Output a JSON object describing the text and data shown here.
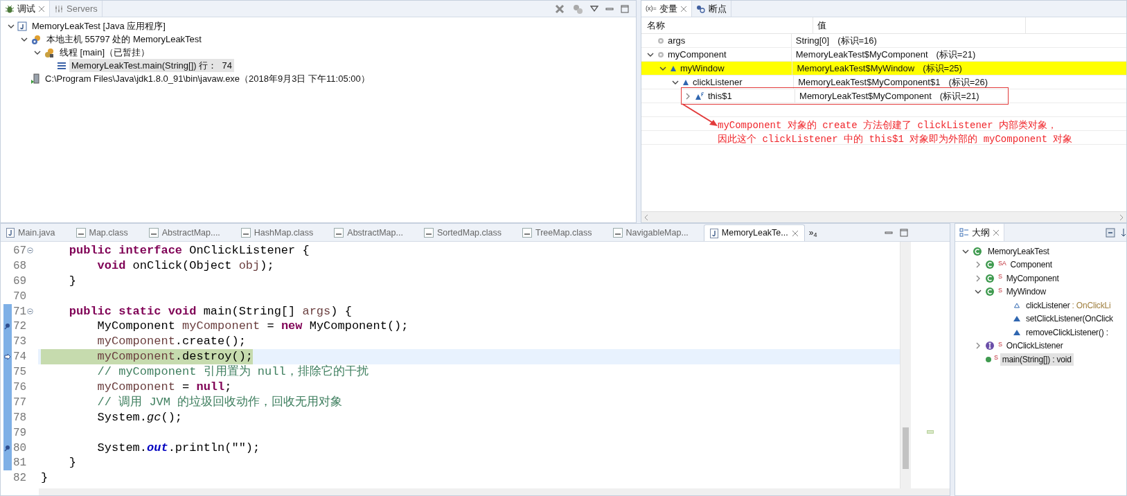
{
  "debug_view": {
    "tabs": [
      {
        "label": "调试",
        "selected": true
      },
      {
        "label": "Servers",
        "selected": false
      }
    ],
    "tree": [
      {
        "kind": "launch",
        "label": "MemoryLeakTest [Java 应用程序]",
        "expanded": true,
        "selected": false,
        "children": [
          {
            "kind": "target",
            "label": "本地主机 55797 处的 MemoryLeakTest",
            "expanded": true,
            "selected": false,
            "children": [
              {
                "kind": "thread",
                "label": "线程 [main]（已暂挂）",
                "expanded": true,
                "selected": false,
                "children": [
                  {
                    "kind": "frame",
                    "label": "MemoryLeakTest.main(String[]) 行：  74",
                    "selected": true
                  }
                ]
              }
            ]
          },
          {
            "kind": "process",
            "label": "C:\\Program Files\\Java\\jdk1.8.0_91\\bin\\javaw.exe（2018年9月3日 下午11:05:00）",
            "selected": false
          }
        ]
      }
    ]
  },
  "variables_view": {
    "tabs": [
      {
        "label": "变量",
        "icon_text": "(x)=",
        "selected": true
      },
      {
        "label": "断点",
        "selected": false
      }
    ],
    "columns": [
      "名称",
      "值"
    ],
    "rows": [
      {
        "kind": "local",
        "name": "args",
        "value": "String[0]",
        "id": "(标识=16)",
        "selected": false
      },
      {
        "kind": "local",
        "name": "myComponent",
        "value": "MemoryLeakTest$MyComponent",
        "id": "(标识=21)",
        "expanded": true,
        "selected": false,
        "children": [
          {
            "kind": "field",
            "name": "myWindow",
            "value": "MemoryLeakTest$MyWindow",
            "id": "(标识=25)",
            "expanded": true,
            "selected": true,
            "children": [
              {
                "kind": "field",
                "name": "clickListener",
                "value": "MemoryLeakTest$MyComponent$1",
                "id": "(标识=26)",
                "expanded": true,
                "selected": false,
                "children": [
                  {
                    "kind": "final_field",
                    "name": "this$1",
                    "value": "MemoryLeakTest$MyComponent",
                    "id": "(标识=21)",
                    "expanded": false,
                    "selected": false,
                    "boxed": true
                  }
                ]
              }
            ]
          }
        ]
      }
    ],
    "annotation": [
      "myComponent 对象的 create 方法创建了 clickListener 内部类对象，",
      "因此这个 clickListener 中的 this$1 对象即为外部的 myComponent 对象"
    ]
  },
  "editor": {
    "tabs": [
      {
        "kind": "java",
        "label": "Main.java",
        "selected": false
      },
      {
        "kind": "class",
        "label": "Map.class",
        "selected": false
      },
      {
        "kind": "class",
        "label": "AbstractMap....",
        "selected": false
      },
      {
        "kind": "class",
        "label": "HashMap.class",
        "selected": false
      },
      {
        "kind": "class",
        "label": "AbstractMap...",
        "selected": false
      },
      {
        "kind": "class",
        "label": "SortedMap.class",
        "selected": false
      },
      {
        "kind": "class",
        "label": "TreeMap.class",
        "selected": false
      },
      {
        "kind": "class",
        "label": "NavigableMap...",
        "selected": false
      },
      {
        "kind": "java",
        "label": "MemoryLeakTe...",
        "selected": true
      }
    ],
    "overflow": "»$_{4}$",
    "lines": [
      {
        "number": "67",
        "fold": true,
        "range": false,
        "current": false,
        "breakpoint": false,
        "tokens": [
          {
            "kind": "keyword",
            "text": "    public interface"
          },
          {
            "kind": "plain",
            "text": " OnClickListener {"
          }
        ]
      },
      {
        "number": "68",
        "fold": false,
        "range": false,
        "current": false,
        "breakpoint": false,
        "tokens": [
          {
            "kind": "keyword",
            "text": "        void"
          },
          {
            "kind": "plain",
            "text": " onClick(Object "
          },
          {
            "kind": "local",
            "text": "obj"
          },
          {
            "kind": "plain",
            "text": ");"
          }
        ]
      },
      {
        "number": "69",
        "fold": false,
        "range": false,
        "current": false,
        "breakpoint": false,
        "tokens": [
          {
            "kind": "plain",
            "text": "    }"
          }
        ]
      },
      {
        "number": "70",
        "fold": false,
        "range": false,
        "current": false,
        "breakpoint": false
      },
      {
        "number": "71",
        "fold": true,
        "range": true,
        "current": false,
        "breakpoint": false,
        "tokens": [
          {
            "kind": "keyword",
            "text": "    public static void"
          },
          {
            "kind": "plain",
            "text": " main(String[] "
          },
          {
            "kind": "local",
            "text": "args"
          },
          {
            "kind": "plain",
            "text": ") {"
          }
        ]
      },
      {
        "number": "72",
        "fold": false,
        "range": true,
        "current": false,
        "breakpoint": true,
        "tokens": [
          {
            "kind": "plain",
            "text": "        MyComponent "
          },
          {
            "kind": "local",
            "text": "myComponent"
          },
          {
            "kind": "plain",
            "text": " = "
          },
          {
            "kind": "keyword",
            "text": "new"
          },
          {
            "kind": "plain",
            "text": " MyComponent();"
          }
        ]
      },
      {
        "number": "73",
        "fold": false,
        "range": true,
        "current": false,
        "breakpoint": false,
        "tokens": [
          {
            "kind": "local",
            "text": "        myComponent"
          },
          {
            "kind": "plain",
            "text": ".create();"
          }
        ]
      },
      {
        "number": "74",
        "fold": false,
        "range": true,
        "current": true,
        "breakpoint": false,
        "tokens": [
          {
            "kind": "local",
            "text": "        myComponent"
          },
          {
            "kind": "plain",
            "text": ".destroy();"
          }
        ]
      },
      {
        "number": "75",
        "fold": false,
        "range": true,
        "current": false,
        "breakpoint": false,
        "tokens": [
          {
            "kind": "comment",
            "text": "        // myComponent 引用置为 null，排除它的干扰"
          }
        ]
      },
      {
        "number": "76",
        "fold": false,
        "range": true,
        "current": false,
        "breakpoint": false,
        "tokens": [
          {
            "kind": "local",
            "text": "        myComponent"
          },
          {
            "kind": "plain",
            "text": " = "
          },
          {
            "kind": "keyword",
            "text": "null"
          },
          {
            "kind": "plain",
            "text": ";"
          }
        ]
      },
      {
        "number": "77",
        "fold": false,
        "range": true,
        "current": false,
        "breakpoint": false,
        "tokens": [
          {
            "kind": "comment",
            "text": "        // 调用 JVM 的垃圾回收动作，回收无用对象"
          }
        ]
      },
      {
        "number": "78",
        "fold": false,
        "range": true,
        "current": false,
        "breakpoint": false,
        "tokens": [
          {
            "kind": "plain",
            "text": "        System."
          },
          {
            "kind": "static_method",
            "text": "gc"
          },
          {
            "kind": "plain",
            "text": "();"
          }
        ]
      },
      {
        "number": "79",
        "fold": false,
        "range": true,
        "current": false,
        "breakpoint": false
      },
      {
        "number": "80",
        "fold": false,
        "range": true,
        "current": false,
        "breakpoint": true,
        "tokens": [
          {
            "kind": "plain",
            "text": "        System."
          },
          {
            "kind": "static_field",
            "text": "out"
          },
          {
            "kind": "plain",
            "text": ".println(\"\");"
          }
        ]
      },
      {
        "number": "81",
        "fold": false,
        "range": true,
        "current": false,
        "breakpoint": false,
        "tokens": [
          {
            "kind": "plain",
            "text": "    }"
          }
        ]
      },
      {
        "number": "82",
        "fold": false,
        "range": false,
        "current": false,
        "breakpoint": false,
        "tokens": [
          {
            "kind": "plain",
            "text": "}"
          }
        ]
      }
    ]
  },
  "outline_view": {
    "tab": "大纲",
    "tree": [
      {
        "kind": "class",
        "name": "MemoryLeakTest",
        "expanded": true,
        "selected": false,
        "children": [
          {
            "kind": "class",
            "name": "Component",
            "badge": "SA",
            "expanded": false,
            "selected": false
          },
          {
            "kind": "class",
            "name": "MyComponent",
            "badge": "S",
            "expanded": false,
            "selected": false
          },
          {
            "kind": "class",
            "name": "MyWindow",
            "badge": "S",
            "expanded": true,
            "selected": false,
            "children": [
              {
                "kind": "field",
                "name": "clickListener",
                "detail": " : OnClickLi",
                "selected": false
              },
              {
                "kind": "method",
                "name": "setClickListener(OnClick",
                "selected": false
              },
              {
                "kind": "method",
                "name": "removeClickListener() :",
                "selected": false
              }
            ]
          },
          {
            "kind": "interface",
            "name": "OnClickListener",
            "badge": "S",
            "expanded": false,
            "selected": false
          },
          {
            "kind": "main_method",
            "name": "main(String[]) : void",
            "badge": "S",
            "selected": true
          }
        ]
      }
    ]
  }
}
